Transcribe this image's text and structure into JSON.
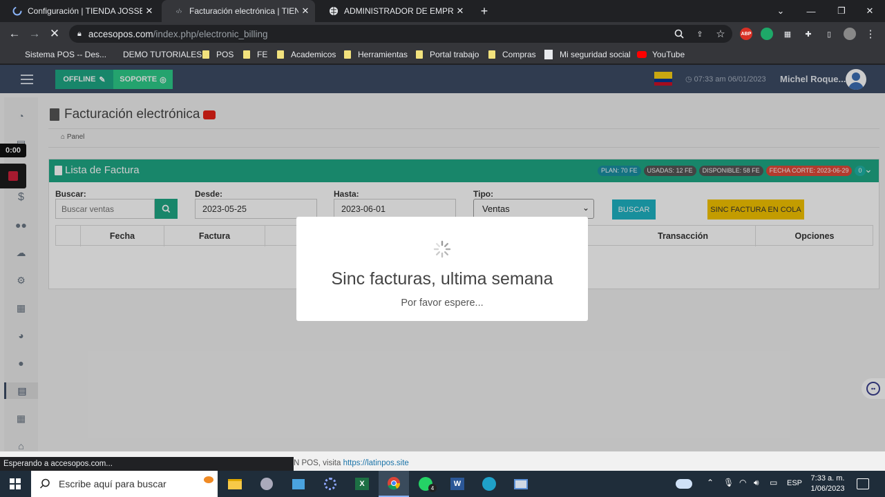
{
  "browser": {
    "tabs": [
      {
        "title": "Configuración | TIENDA JOSSE",
        "close": "✕"
      },
      {
        "title": "Facturación electrónica | TIENDA",
        "close": "✕"
      },
      {
        "title": "ADMINISTRADOR DE EMPRESAS",
        "close": "✕"
      }
    ],
    "new_tab": "+",
    "url_host": "accesopos.com",
    "url_path": "/index.php/electronic_billing",
    "bookmarks": [
      "Sistema POS -- Des...",
      "DEMO TUTORIALES",
      "POS",
      "FE",
      "Academicos",
      "Herramientas",
      "Portal trabajo",
      "Compras",
      "Mi seguridad social",
      "YouTube"
    ],
    "ext_abp": "ABP"
  },
  "app": {
    "btn_offline": "OFFLINE",
    "btn_soporte": "SOPORTE",
    "datetime": "07:33 am 06/01/2023",
    "user": "Michel Roque...",
    "page_title": "Facturación electrónica",
    "breadcrumb": "Panel",
    "panel_title": "Lista de Factura",
    "badges": {
      "plan": "PLAN: 70 FE",
      "usadas": "USADAS: 12 FE",
      "disponible": "DISPONIBLE: 58 FE",
      "fecha_corte": "FECHA CORTE: 2023-06-29",
      "count": "0"
    },
    "filters": {
      "buscar_label": "Buscar:",
      "buscar_placeholder": "Buscar ventas",
      "desde_label": "Desde:",
      "desde_value": "2023-05-25",
      "hasta_label": "Hasta:",
      "hasta_value": "2023-06-01",
      "tipo_label": "Tipo:",
      "tipo_value": "Ventas",
      "btn_buscar": "BUSCAR",
      "btn_sinc": "SINC FACTURA EN COLA"
    },
    "table_headers": [
      "Fecha",
      "Factura",
      "Transacción",
      "Opciones"
    ],
    "timer": "0:00"
  },
  "modal": {
    "title": "Sinc facturas, ultima semana",
    "subtitle": "Por favor espere..."
  },
  "status": {
    "loading": "Esperando a accesopos.com...",
    "footer_prefix": "N POS, visita ",
    "footer_link": "https://latinpos.site"
  },
  "taskbar": {
    "search_placeholder": "Escribe aquí para buscar",
    "lang": "ESP",
    "time": "7:33 a. m.",
    "date": "1/06/2023",
    "whatsapp_count": "4"
  },
  "colors": {
    "green": "#1ea885",
    "teal": "#1fb3a7",
    "dark_nav": "#3c4b64",
    "yellow": "#f4c300",
    "red_badge": "#e04a3a"
  }
}
